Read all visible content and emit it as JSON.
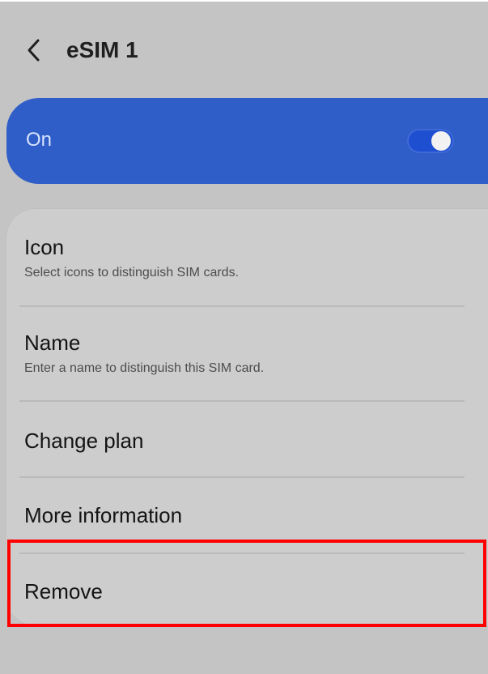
{
  "header": {
    "back_icon": "chevron-left-icon",
    "title": "eSIM 1"
  },
  "toggle": {
    "label": "On",
    "state": "on",
    "accent": "#2f5ec8"
  },
  "items": [
    {
      "title": "Icon",
      "subtitle": "Select icons to distinguish SIM cards."
    },
    {
      "title": "Name",
      "subtitle": "Enter a name to distinguish this SIM card."
    },
    {
      "title": "Change plan"
    },
    {
      "title": "More information"
    },
    {
      "title": "Remove",
      "highlighted": true
    }
  ]
}
